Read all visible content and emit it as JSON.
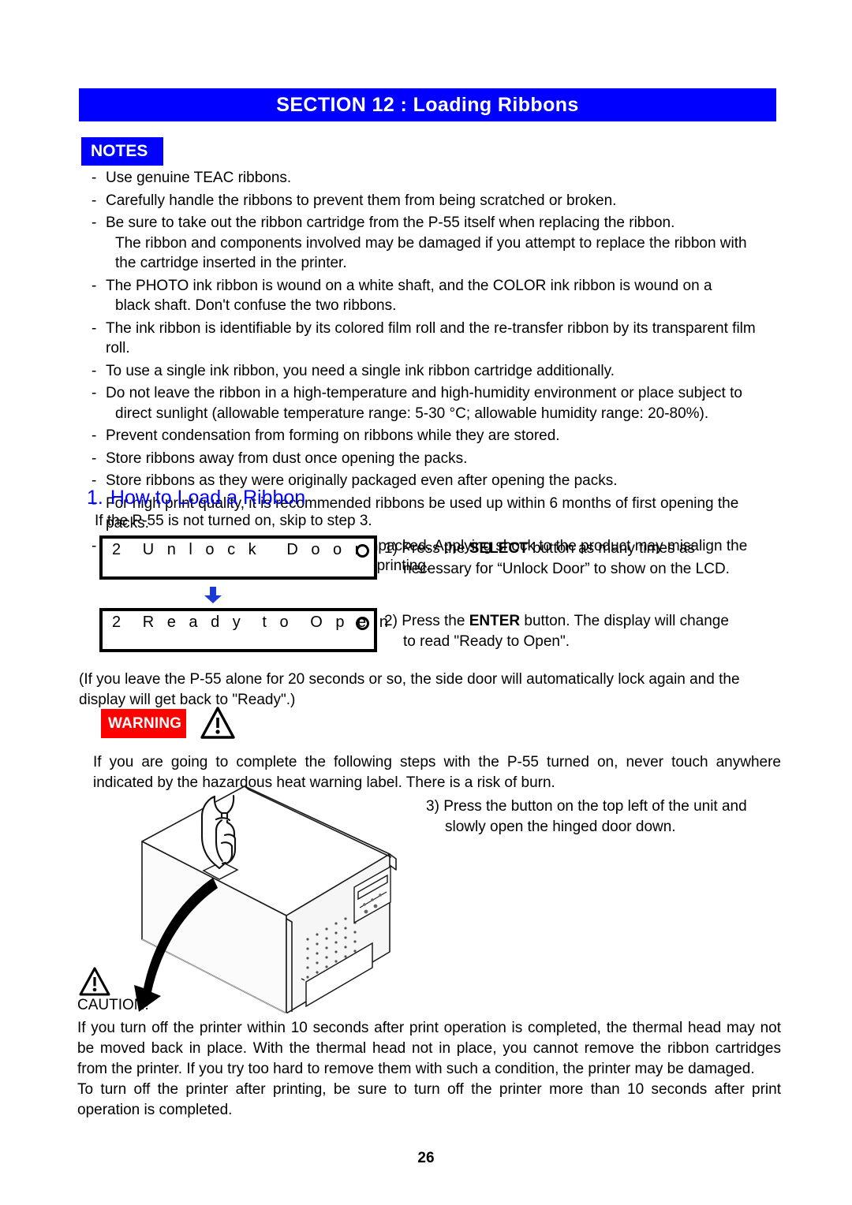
{
  "header": {
    "section_title": "SECTION 12 :  Loading Ribbons"
  },
  "notes": {
    "badge_label": "NOTES",
    "items": [
      {
        "lines": [
          "Use genuine TEAC ribbons."
        ]
      },
      {
        "lines": [
          "Carefully handle the ribbons to prevent them from being scratched or broken."
        ]
      },
      {
        "lines": [
          "Be sure to take out the ribbon cartridge from the P-55 itself when replacing the ribbon.",
          "The ribbon and components involved may be damaged if you attempt to replace the ribbon with",
          "the cartridge inserted in the printer."
        ]
      },
      {
        "lines": [
          "The PHOTO ink ribbon is wound on a white shaft, and the COLOR ink ribbon is wound on a",
          "black shaft. Don't confuse the two ribbons."
        ]
      },
      {
        "lines": [
          "The ink ribbon is identifiable by its colored film roll and the re-transfer ribbon by its transparent film roll."
        ]
      },
      {
        "lines": [
          "To use a single ink ribbon, you need a single ink ribbon cartridge additionally."
        ]
      },
      {
        "lines": [
          "Do not leave the ribbon in a high-temperature and high-humidity environment or place subject to",
          "direct sunlight (allowable temperature range: 5-30 °C; allowable humidity range: 20-80%)."
        ]
      },
      {
        "lines": [
          "Prevent condensation from forming on ribbons while they are stored."
        ]
      },
      {
        "lines": [
          "Store ribbons away from dust once opening the packs."
        ]
      },
      {
        "lines": [
          "Store ribbons as they were originally packaged even after opening the packs."
        ]
      },
      {
        "lines": [
          "For high print quality, it is recommended ribbons be used up within 6 months of first opening the packs."
        ]
      },
      {
        "lines": [
          "Do not apply any shock to the product unpacked. Applying shock to the product may misalign the",
          "spools of ribbons, resulting in improper printing."
        ]
      }
    ],
    "bullet_dash": "-"
  },
  "subsection": {
    "number": "1.",
    "title": "How to Load a Ribbon",
    "intro": "If the P-55 is not turned on, skip to step 3."
  },
  "lcd_displays": [
    {
      "text": "2  U n l o c k   D o o r",
      "indicator": "circle"
    },
    {
      "text": "2  R e a d y  t o  O p e n",
      "indicator": "circle"
    }
  ],
  "steps": [
    {
      "marker": "1)",
      "line1_prefix": "Press the ",
      "line1_bold": "SELECT",
      "line1_suffix": " button as many times as",
      "line2": "necessary for “Unlock Door” to show on the LCD."
    },
    {
      "marker": "2)",
      "line1_prefix": "Press the ",
      "line1_bold": "ENTER",
      "line1_suffix": " button. The display will change",
      "line2": "to read \"Ready to Open\"."
    },
    {
      "marker": "3)",
      "line1_prefix": "Press the button on the top left of the unit and",
      "line1_bold": "",
      "line1_suffix": "",
      "line2": "slowly open the hinged door down."
    }
  ],
  "paren_note": "(If you leave the P-55 alone for 20 seconds or so, the side door will automatically lock again and the display will get back to \"Ready\".)",
  "warning": {
    "badge_label": "WARNING",
    "body": "If you are going to complete the following steps with the P-55 turned on, never touch anywhere indicated by the hazardous heat warning label. There is a risk of burn."
  },
  "caution": {
    "label": "CAUTION!",
    "paragraphs": [
      "If you turn off the printer within 10 seconds after print operation is completed, the thermal head may not be moved back in place. With the thermal head not in place, you cannot remove the ribbon cartridges from the printer. If you try too hard to remove them with such a condition, the printer may be damaged.",
      "To turn off the printer after printing, be sure to turn off the printer more than 10 seconds after print operation is completed."
    ]
  },
  "footer": {
    "page_number": "26"
  },
  "colors": {
    "section_blue": "#0000ff",
    "warning_red": "#ff0000",
    "heading_blue": "#0000ff",
    "text_black": "#000000"
  }
}
